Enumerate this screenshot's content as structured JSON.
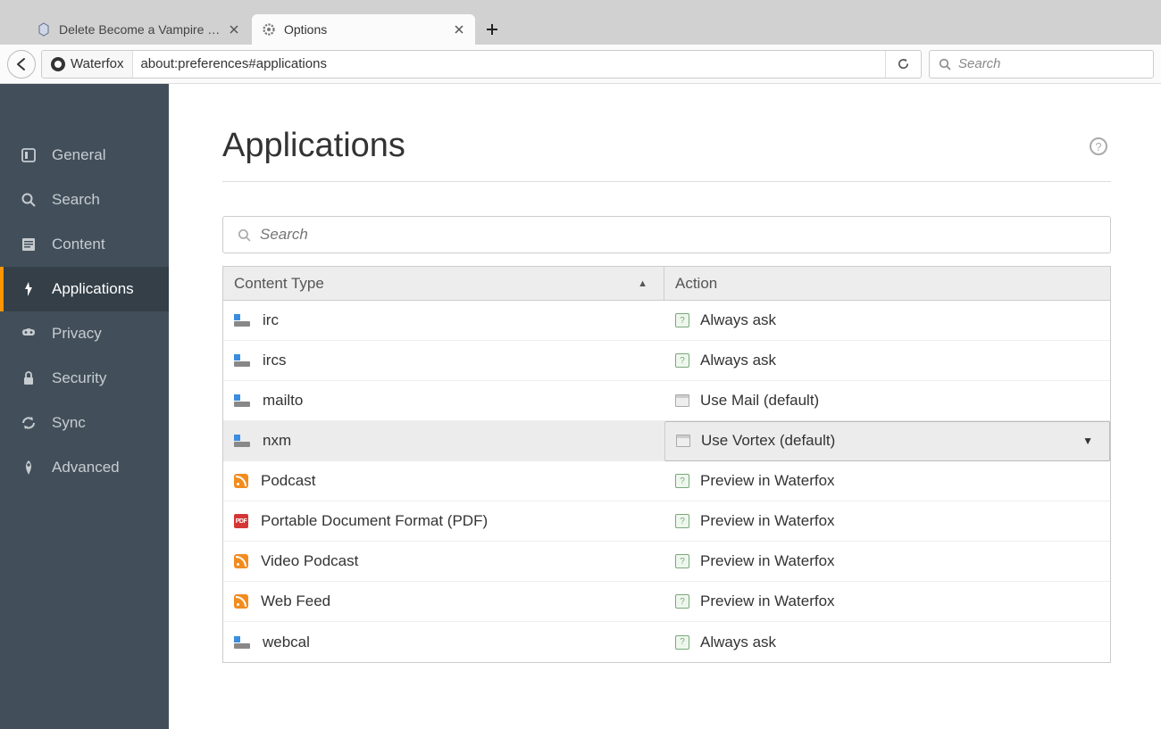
{
  "tabs": [
    {
      "title": "Delete Become a Vampire L…",
      "active": false
    },
    {
      "title": "Options",
      "active": true
    }
  ],
  "urlbar": {
    "identity": "Waterfox",
    "address": "about:preferences#applications"
  },
  "searchbox": {
    "placeholder": "Search"
  },
  "sidebar": {
    "items": [
      {
        "id": "general",
        "label": "General"
      },
      {
        "id": "search",
        "label": "Search"
      },
      {
        "id": "content",
        "label": "Content"
      },
      {
        "id": "applications",
        "label": "Applications"
      },
      {
        "id": "privacy",
        "label": "Privacy"
      },
      {
        "id": "security",
        "label": "Security"
      },
      {
        "id": "sync",
        "label": "Sync"
      },
      {
        "id": "advanced",
        "label": "Advanced"
      }
    ],
    "active": "applications"
  },
  "page": {
    "title": "Applications",
    "search_placeholder": "Search",
    "columns": {
      "content_type": "Content Type",
      "action": "Action"
    }
  },
  "applications": [
    {
      "type": "irc",
      "icon": "proto",
      "action": "Always ask",
      "action_icon": "ask",
      "selected": false
    },
    {
      "type": "ircs",
      "icon": "proto",
      "action": "Always ask",
      "action_icon": "ask",
      "selected": false
    },
    {
      "type": "mailto",
      "icon": "proto",
      "action": "Use Mail (default)",
      "action_icon": "app",
      "selected": false
    },
    {
      "type": "nxm",
      "icon": "proto",
      "action": "Use Vortex (default)",
      "action_icon": "app",
      "selected": true
    },
    {
      "type": "Podcast",
      "icon": "rss",
      "action": "Preview in Waterfox",
      "action_icon": "ask",
      "selected": false
    },
    {
      "type": "Portable Document Format (PDF)",
      "icon": "pdf",
      "action": "Preview in Waterfox",
      "action_icon": "ask",
      "selected": false
    },
    {
      "type": "Video Podcast",
      "icon": "rss",
      "action": "Preview in Waterfox",
      "action_icon": "ask",
      "selected": false
    },
    {
      "type": "Web Feed",
      "icon": "rss",
      "action": "Preview in Waterfox",
      "action_icon": "ask",
      "selected": false
    },
    {
      "type": "webcal",
      "icon": "proto",
      "action": "Always ask",
      "action_icon": "ask",
      "selected": false
    }
  ]
}
